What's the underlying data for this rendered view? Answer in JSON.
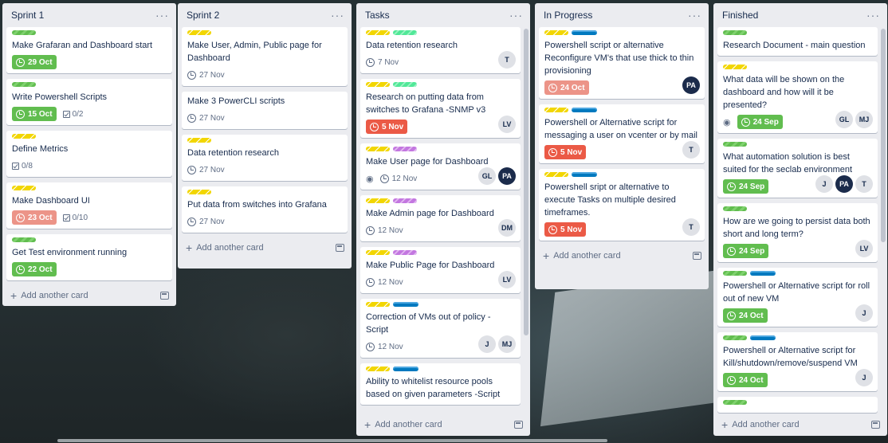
{
  "board": {
    "add_card_label": "Add another card",
    "lists": [
      {
        "title": "Sprint 1",
        "cards": [
          {
            "labels": [
              "green"
            ],
            "title": "Make Grafaran and Dashboard start",
            "due": {
              "text": "29 Oct",
              "state": "complete"
            }
          },
          {
            "labels": [
              "green"
            ],
            "title": "Write Powershell Scripts",
            "due": {
              "text": "15 Oct",
              "state": "complete"
            },
            "checklist": "0/2"
          },
          {
            "labels": [
              "yellow"
            ],
            "title": "Define Metrics",
            "checklist": "0/8"
          },
          {
            "labels": [
              "yellow"
            ],
            "title": "Make Dashboard UI",
            "due": {
              "text": "23 Oct",
              "state": "pastdue"
            },
            "checklist": "0/10"
          },
          {
            "labels": [
              "green"
            ],
            "title": "Get Test environment running",
            "due": {
              "text": "22 Oct",
              "state": "complete"
            }
          }
        ]
      },
      {
        "title": "Sprint 2",
        "cards": [
          {
            "labels": [
              "yellow"
            ],
            "title": "Make User, Admin, Public page for Dashboard",
            "due": {
              "text": "27 Nov",
              "state": "plain"
            }
          },
          {
            "labels": [],
            "title": "Make 3 PowerCLI scripts",
            "due": {
              "text": "27 Nov",
              "state": "plain"
            }
          },
          {
            "labels": [
              "yellow"
            ],
            "title": "Data retention research",
            "due": {
              "text": "27 Nov",
              "state": "plain"
            }
          },
          {
            "labels": [
              "yellow"
            ],
            "title": "Put data from switches into Grafana",
            "due": {
              "text": "27 Nov",
              "state": "plain"
            }
          }
        ]
      },
      {
        "title": "Tasks",
        "cards": [
          {
            "labels": [
              "yellow",
              "teal"
            ],
            "title": "Data retention research",
            "due": {
              "text": "7 Nov",
              "state": "plain"
            },
            "members": [
              "T"
            ]
          },
          {
            "labels": [
              "yellow",
              "teal"
            ],
            "title": "Research on putting data from switches to Grafana -SNMP v3",
            "due": {
              "text": "5 Nov",
              "state": "overdue"
            },
            "members": [
              "LV"
            ]
          },
          {
            "labels": [
              "yellow",
              "purple"
            ],
            "title": "Make User page for Dashboard",
            "watch": true,
            "due": {
              "text": "12 Nov",
              "state": "plain"
            },
            "members": [
              "GL",
              "PA"
            ]
          },
          {
            "labels": [
              "yellow",
              "purple"
            ],
            "title": "Make Admin page for Dashboard",
            "due": {
              "text": "12 Nov",
              "state": "plain"
            },
            "members": [
              "DM"
            ]
          },
          {
            "labels": [
              "yellow",
              "purple"
            ],
            "title": "Make Public Page for Dashboard",
            "due": {
              "text": "12 Nov",
              "state": "plain"
            },
            "members": [
              "LV"
            ]
          },
          {
            "labels": [
              "yellow",
              "blue"
            ],
            "title": "Correction of VMs out of policy - Script",
            "due": {
              "text": "12 Nov",
              "state": "plain"
            },
            "members": [
              "J",
              "MJ"
            ]
          },
          {
            "labels": [
              "yellow",
              "blue"
            ],
            "title": "Ability to whitelist resource pools based on given parameters -Script"
          }
        ]
      },
      {
        "title": "In Progress",
        "cards": [
          {
            "labels": [
              "yellow",
              "blue"
            ],
            "title": "Powershell script or alternative Reconfigure VM's that use thick to thin provisioning",
            "due": {
              "text": "24 Oct",
              "state": "pastdue"
            },
            "members": [
              "PA"
            ]
          },
          {
            "labels": [
              "yellow",
              "blue"
            ],
            "title": "Powershell or Alternative script for messaging a user on vcenter or by mail",
            "due": {
              "text": "5 Nov",
              "state": "overdue"
            },
            "members": [
              "T"
            ]
          },
          {
            "labels": [
              "yellow",
              "blue"
            ],
            "title": "Powershell sript or alternative to execute Tasks on multiple desired timeframes.",
            "due": {
              "text": "5 Nov",
              "state": "overdue"
            },
            "members": [
              "T"
            ]
          }
        ]
      },
      {
        "title": "Finished",
        "cards": [
          {
            "labels": [
              "green"
            ],
            "title": "Research Document - main question"
          },
          {
            "labels": [
              "yellow"
            ],
            "title": "What data will be shown on the dashboard and how will it be presented?",
            "watch": true,
            "due": {
              "text": "24 Sep",
              "state": "complete"
            },
            "members": [
              "GL",
              "MJ"
            ]
          },
          {
            "labels": [
              "green"
            ],
            "title": "What automation solution is best suited for the seclab environment",
            "due": {
              "text": "24 Sep",
              "state": "complete"
            },
            "members": [
              "J",
              "PA",
              "T"
            ]
          },
          {
            "labels": [
              "green"
            ],
            "title": "How are we going to persist data both short and long term?",
            "due": {
              "text": "24 Sep",
              "state": "complete"
            },
            "members": [
              "LV"
            ]
          },
          {
            "labels": [
              "green",
              "blue"
            ],
            "title": "Powershell or Alternative script for roll out of new VM",
            "due": {
              "text": "24 Oct",
              "state": "complete"
            },
            "members": [
              "J"
            ]
          },
          {
            "labels": [
              "green",
              "blue"
            ],
            "title": "Powershell or Alternative script for Kill/shutdown/remove/suspend VM",
            "due": {
              "text": "24 Oct",
              "state": "complete"
            },
            "members": [
              "J"
            ]
          },
          {
            "labels": [
              "green"
            ],
            "title": ""
          }
        ]
      }
    ]
  }
}
